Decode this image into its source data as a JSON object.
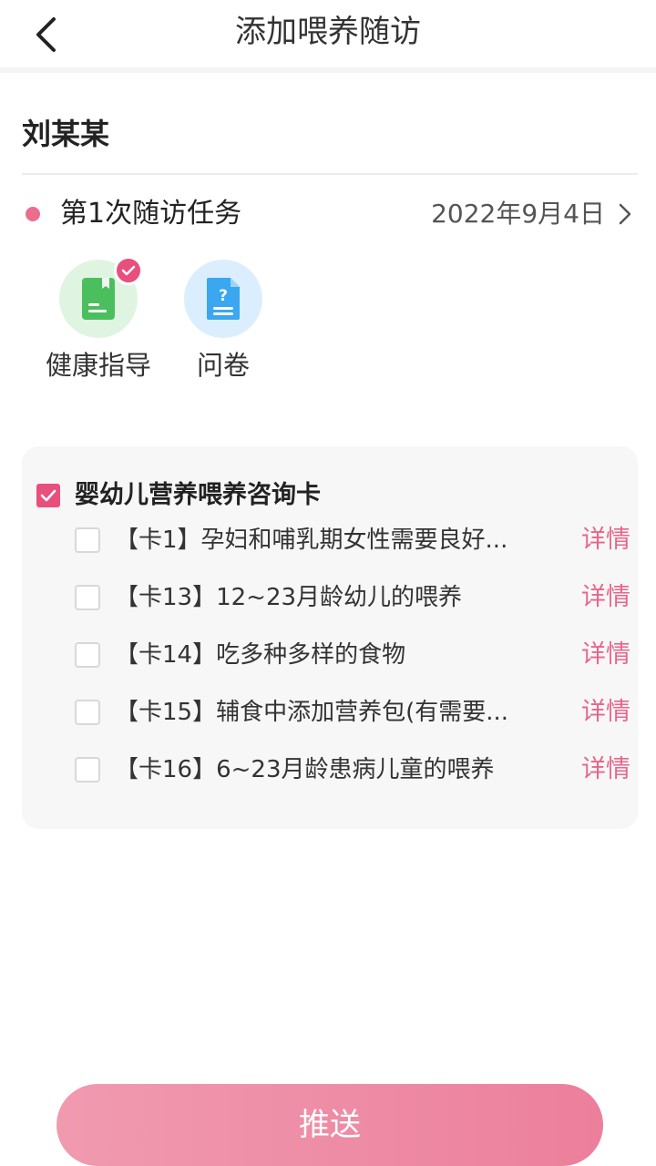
{
  "header": {
    "title": "添加喂养随访"
  },
  "patient": {
    "name": "刘某某"
  },
  "task": {
    "title": "第1次随访任务",
    "date": "2022年9月4日"
  },
  "types": [
    {
      "label": "健康指导",
      "icon": "document-green-icon",
      "checked": true
    },
    {
      "label": "问卷",
      "icon": "questionnaire-blue-icon",
      "checked": false
    }
  ],
  "card_group": {
    "label": "婴幼儿营养喂养咨询卡",
    "checked": true,
    "items": [
      {
        "text": "【卡1】孕妇和哺乳期女性需要良好...",
        "detail": "详情",
        "checked": false
      },
      {
        "text": "【卡13】12~23月龄幼儿的喂养",
        "detail": "详情",
        "checked": false
      },
      {
        "text": "【卡14】吃多种多样的食物",
        "detail": "详情",
        "checked": false
      },
      {
        "text": "【卡15】辅食中添加营养包(有需要...",
        "detail": "详情",
        "checked": false
      },
      {
        "text": "【卡16】6~23月龄患病儿童的喂养",
        "detail": "详情",
        "checked": false
      }
    ]
  },
  "actions": {
    "push_label": "推送"
  },
  "colors": {
    "accent": "#e94f7c",
    "link": "#e9668a",
    "button_start": "#f09ab0",
    "button_end": "#ec7f9c"
  }
}
